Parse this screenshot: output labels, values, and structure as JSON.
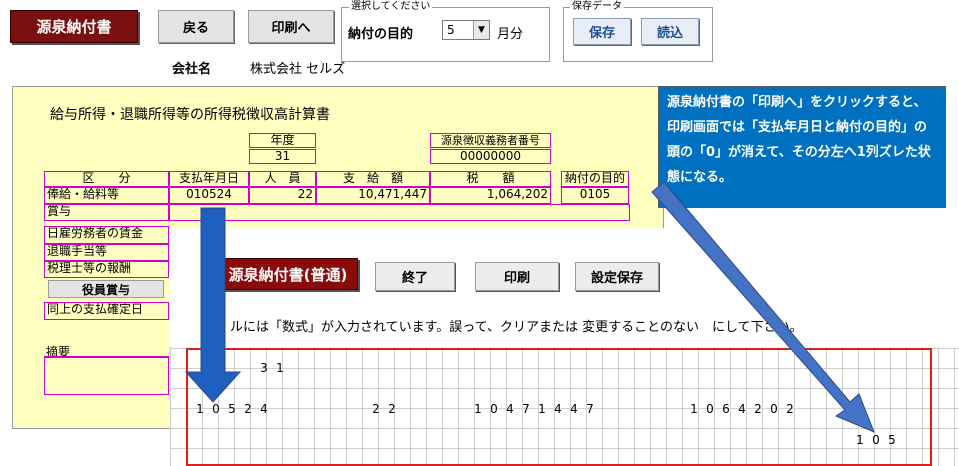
{
  "toolbar": {
    "title_label": "源泉納付書",
    "back_label": "戻る",
    "print_label": "印刷へ",
    "selection_legend": "選択してください",
    "month_label": "納付の目的",
    "month_value": "5",
    "month_unit": "月分",
    "save_data_legend": "保存データ",
    "save_label": "保存",
    "load_label": "読込"
  },
  "company": {
    "label": "会社名",
    "value": "株式会社 セルズ"
  },
  "form": {
    "heading": "給与所得・退職所得等の所得税徴収高計算書",
    "year_header": "年度",
    "year_value": "31",
    "agent_header": "源泉徴収義務者番号",
    "agent_value": "00000000",
    "col_category": "区　　分",
    "col_date": "支払年月日",
    "col_people": "人　員",
    "col_amount": "支　給　額",
    "col_tax": "税　　額",
    "col_purpose": "納付の目的",
    "rows": [
      "俸給・給料等",
      "賞与",
      "日雇労務者の賃金",
      "退職手当等",
      "税理士等の報酬",
      "役員賞与",
      "同上の支払確定日"
    ],
    "row1_date": "010524",
    "row1_people": "22",
    "row1_amount": "10,471,447",
    "row1_tax": "1,064,202",
    "row1_purpose": "0105",
    "memo_label": "摘要"
  },
  "callout": {
    "text": "源泉納付書の「印刷へ」をクリックすると、印刷画面では「支払年月日と納付の目的」の頭の「0」が消えて、その分左へ1列ズレた状態になる。"
  },
  "print_window": {
    "title_label": "源泉納付書(普通)",
    "exit_label": "終了",
    "print_label": "印刷",
    "settings_label": "設定保存",
    "notice": "ルには「数式」が入力されています。誤って、クリアまたは 変更することのない　にして下さい。",
    "year_digits": [
      "3",
      "1"
    ],
    "date_digits": [
      "1",
      "0",
      "5",
      "2",
      "4"
    ],
    "people_digits": [
      "2",
      "2"
    ],
    "amount_digits": [
      "1",
      "0",
      "4",
      "7",
      "1",
      "4",
      "4",
      "7"
    ],
    "tax_digits": [
      "1",
      "0",
      "6",
      "4",
      "2",
      "0",
      "2"
    ],
    "purpose_digits": [
      "1",
      "0",
      "5"
    ]
  },
  "colors": {
    "arrow": "#1f5fbf",
    "callout": "#0070c0",
    "title": "#7a0f0f",
    "grid_border": "#e02020",
    "form_border": "#d100d1"
  }
}
